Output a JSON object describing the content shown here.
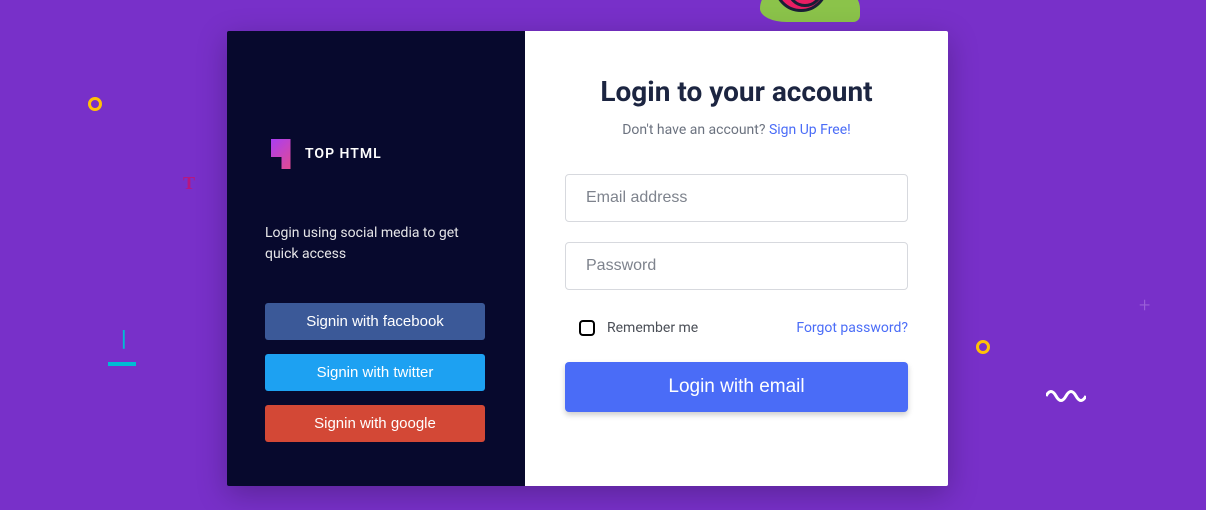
{
  "brand": {
    "name": "TOP HTML"
  },
  "left": {
    "intro": "Login using social media to get quick access",
    "facebook": "Signin with facebook",
    "twitter": "Signin with twitter",
    "google": "Signin with google"
  },
  "right": {
    "title": "Login to your account",
    "subtitle_prefix": "Don't have an account? ",
    "signup_link": "Sign Up Free!",
    "email_placeholder": "Email address",
    "password_placeholder": "Password",
    "remember": "Remember me",
    "forgot": "Forgot password?",
    "login_button": "Login with email"
  }
}
